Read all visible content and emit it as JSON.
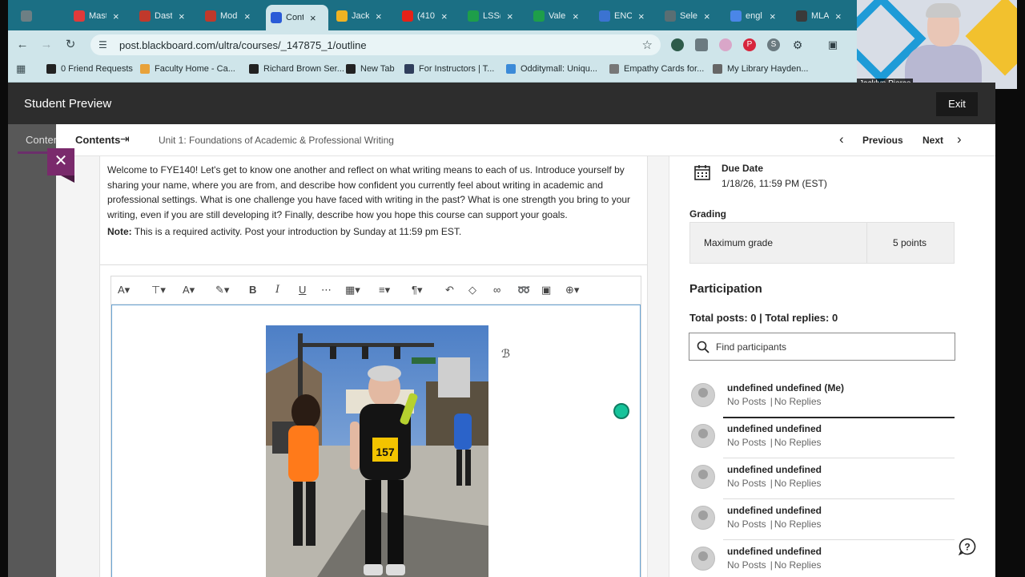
{
  "browser": {
    "tabs": [
      {
        "label": "",
        "color": "#6d7f84"
      },
      {
        "label": "Mast",
        "color": "#e03a3a"
      },
      {
        "label": "Dast",
        "color": "#c0392b"
      },
      {
        "label": "Mod",
        "color": "#c0392b"
      },
      {
        "label": "Cont",
        "color": "#2a5bd7"
      },
      {
        "label": "Jack",
        "color": "#f0b323"
      },
      {
        "label": "(410",
        "color": "#e62117"
      },
      {
        "label": "LSS(",
        "color": "#1e9e4a"
      },
      {
        "label": "Vale",
        "color": "#1e9e4a"
      },
      {
        "label": "ENC",
        "color": "#3b73d1"
      },
      {
        "label": "Sele",
        "color": "#5a6e73"
      },
      {
        "label": "engl",
        "color": "#4a86e8"
      },
      {
        "label": "MLA",
        "color": "#3a3a3a"
      }
    ],
    "url": "post.blackboard.com/ultra/courses/_147875_1/outline",
    "bookmarks": [
      {
        "label": "0 Friend Requests",
        "color": "#222"
      },
      {
        "label": "Faculty Home - Ca...",
        "color": "#e8a23a"
      },
      {
        "label": "Richard Brown Ser...",
        "color": "#222"
      },
      {
        "label": "New Tab",
        "color": "#222"
      },
      {
        "label": "For Instructors | T...",
        "color": "#2f3e5c"
      },
      {
        "label": "Odditymall: Uniqu...",
        "color": "#3b8ad8"
      },
      {
        "label": "Empathy Cards for...",
        "color": "#777"
      },
      {
        "label": "My Library Hayden...",
        "color": "#666"
      }
    ]
  },
  "webcam": {
    "name": "Jacklyn Pierce"
  },
  "preview": {
    "title": "Student Preview",
    "exit": "Exit"
  },
  "behind": {
    "label": "Conter"
  },
  "nav": {
    "contents": "Contents",
    "unit": "Unit 1: Foundations of Academic & Professional Writing",
    "previous": "Previous",
    "next": "Next"
  },
  "prompt": {
    "text": "Welcome to FYE140! Let's get to know one another and reflect on what writing means to each of us. Introduce yourself by sharing your name, where you are from, and describe how confident you currently feel about writing in academic and professional settings. What is one challenge you have faced with writing in the past? What is one strength you bring to your writing, even if you are still developing it? Finally, describe how you hope this course can support your goals.",
    "note_label": "Note:",
    "note_text": " This is a required activity. Post your introduction by Sunday at 11:59 pm EST."
  },
  "due": {
    "label": "Due Date",
    "value": "1/18/26, 11:59 PM (EST)"
  },
  "grading": {
    "label": "Grading",
    "max_label": "Maximum grade",
    "points": "5 points"
  },
  "participation": {
    "title": "Participation",
    "counts": "Total posts: 0 | Total replies: 0",
    "search_placeholder": "Find participants",
    "people": [
      {
        "name": "undefined undefined (Me)",
        "posts": "No Posts",
        "replies": "No Replies"
      },
      {
        "name": "undefined undefined",
        "posts": "No Posts",
        "replies": "No Replies"
      },
      {
        "name": "undefined undefined",
        "posts": "No Posts",
        "replies": "No Replies"
      },
      {
        "name": "undefined undefined",
        "posts": "No Posts",
        "replies": "No Replies"
      },
      {
        "name": "undefined undefined",
        "posts": "No Posts",
        "replies": "No Replies"
      }
    ]
  },
  "photo": {
    "bib_number": "157"
  }
}
